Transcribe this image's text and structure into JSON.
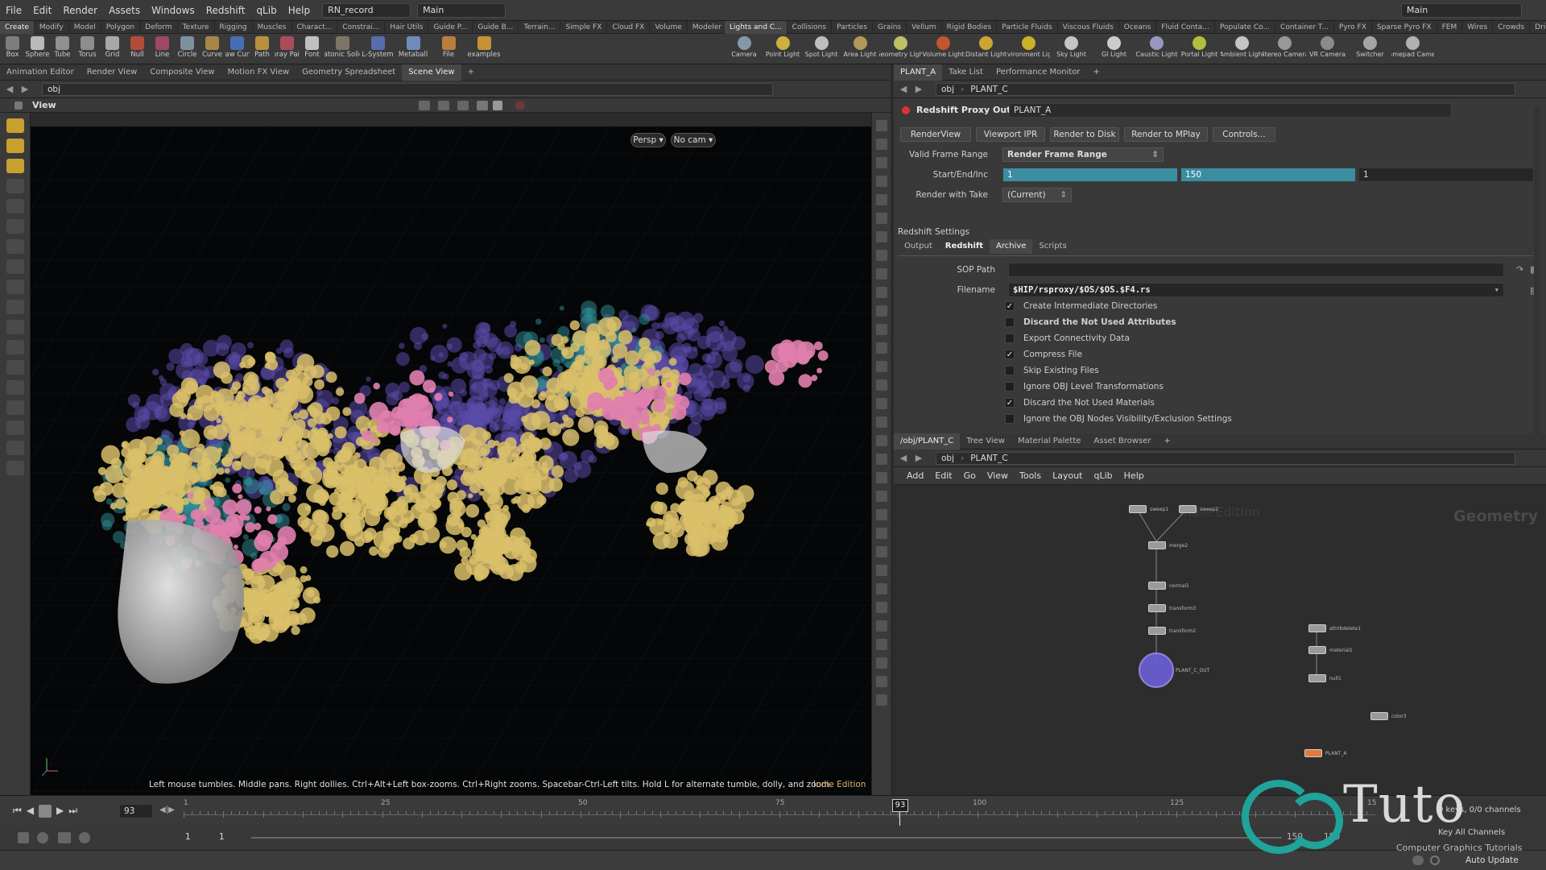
{
  "menubar": {
    "items": [
      "File",
      "Edit",
      "Render",
      "Assets",
      "Windows",
      "Redshift",
      "qLib",
      "Help"
    ],
    "file_field": "RN_record",
    "desktop_field": "Main",
    "right_desktop": "Main"
  },
  "shelf": {
    "left_tabs": [
      "Create",
      "Modify",
      "Model",
      "Polygon",
      "Deform",
      "Texture",
      "Rigging",
      "Muscles",
      "Charact...",
      "Constrai...",
      "Hair Utils",
      "Guide P...",
      "Guide B...",
      "Terrain...",
      "Simple FX",
      "Cloud FX",
      "Volume",
      "Modeler"
    ],
    "left_tools": [
      "Box",
      "Sphere",
      "Tube",
      "Torus",
      "Grid",
      "Null",
      "Line",
      "Circle",
      "Curve",
      "Draw Curve",
      "Path",
      "Spray Paint",
      "Font",
      "Platonic Solids",
      "L-System",
      "Metaball",
      "File",
      "examples"
    ],
    "right_tabs": [
      "Lights and C...",
      "Collisions",
      "Particles",
      "Grains",
      "Vellum",
      "Rigid Bodies",
      "Particle Fluids",
      "Viscous Fluids",
      "Oceans",
      "Fluid Conta...",
      "Populate Co...",
      "Container T...",
      "Pyro FX",
      "Sparse Pyro FX",
      "FEM",
      "Wires",
      "Crowds",
      "Drive Simul..."
    ],
    "right_tools": [
      "Camera",
      "Point Light",
      "Spot Light",
      "Area Light",
      "Geometry Light",
      "Volume Light",
      "Distant Light",
      "Environment Light",
      "Sky Light",
      "GI Light",
      "Caustic Light",
      "Portal Light",
      "Ambient Light",
      "Stereo Camera",
      "VR Camera",
      "Switcher",
      "Gamepad Camera"
    ]
  },
  "left_pane": {
    "tabs": [
      "Animation Editor",
      "Render View",
      "Composite View",
      "Motion FX View",
      "Geometry Spreadsheet",
      "Scene View"
    ],
    "path": "obj",
    "view_label": "View",
    "persp_btn": "Persp ▾",
    "cam_btn": "No cam ▾",
    "hint": "Left mouse tumbles. Middle pans. Right dollies. Ctrl+Alt+Left box-zooms. Ctrl+Right zooms. Spacebar-Ctrl-Left tilts. Hold L for alternate tumble, dolly, and zoom.",
    "edition": "Indie Edition"
  },
  "param_pane": {
    "tabs": [
      "PLANT_A",
      "Take List",
      "Performance Monitor"
    ],
    "path_obj": "obj",
    "path_node": "PLANT_C",
    "node_type": "Redshift Proxy Output",
    "node_name": "PLANT_A",
    "buttons": [
      "RenderView",
      "Viewport IPR",
      "Render to Disk",
      "Render to MPlay",
      "Controls..."
    ],
    "valid_frame_range_label": "Valid Frame Range",
    "valid_frame_range_value": "Render Frame Range",
    "start_end_inc_label": "Start/End/Inc",
    "start": "1",
    "end": "150",
    "inc": "1",
    "render_with_take_label": "Render with Take",
    "render_with_take_value": "(Current)",
    "section": "Redshift Settings",
    "subtabs": [
      "Output",
      "Redshift",
      "Archive",
      "Scripts"
    ],
    "sop_path_label": "SOP Path",
    "sop_path_value": "",
    "filename_label": "Filename",
    "filename_value": "$HIP/rsproxy/$OS/$OS.$F4.rs",
    "checkboxes": [
      {
        "label": "Create Intermediate Directories",
        "checked": true
      },
      {
        "label": "Discard the Not Used Attributes",
        "checked": false
      },
      {
        "label": "Export Connectivity Data",
        "checked": false
      },
      {
        "label": "Compress File",
        "checked": true
      },
      {
        "label": "Skip Existing Files",
        "checked": false
      },
      {
        "label": "Ignore OBJ Level Transformations",
        "checked": false
      },
      {
        "label": "Discard the Not Used Materials",
        "checked": true
      },
      {
        "label": "Ignore the OBJ Nodes Visibility/Exclusion Settings",
        "checked": false
      }
    ]
  },
  "network_pane": {
    "tabs": [
      "/obj/PLANT_C",
      "Tree View",
      "Material Palette",
      "Asset Browser"
    ],
    "path_obj": "obj",
    "path_node": "PLANT_C",
    "menu": [
      "Add",
      "Edit",
      "Go",
      "View",
      "Tools",
      "Layout",
      "qLib",
      "Help"
    ],
    "watermark_edition": "Indie Edition",
    "watermark_context": "Geometry",
    "nodes": [
      "sweep1",
      "sweep2",
      "merge2",
      "normal1",
      "transform3",
      "transform2",
      "PLANT_C_OUT",
      "attribdelete1",
      "material1",
      "null1",
      "color3",
      "PLANT_A"
    ]
  },
  "timeline": {
    "current_frame": "93",
    "ticks": [
      "1",
      "25",
      "50",
      "75",
      "100",
      "125",
      "15"
    ],
    "range_start": "1",
    "range_start2": "1",
    "range_end": "150",
    "range_end2": "150",
    "keys_info": "0 keys, 0/0 channels",
    "key_all": "Key All Channels",
    "auto_update": "Auto Update"
  },
  "watermark": {
    "logo_letters": "CG",
    "brand": "Tuto",
    "tagline": "Computer Graphics Tutorials"
  },
  "colors": {
    "yellow_foliage": "#d9c06a",
    "purple_foliage": "#5a4aa8",
    "teal_foliage": "#2f8f98",
    "pink_spheres": "#e07fae",
    "node_highlight": "#6d5fd8",
    "param_field_teal": "#3b8da0",
    "brand_teal": "#1fa39a"
  }
}
